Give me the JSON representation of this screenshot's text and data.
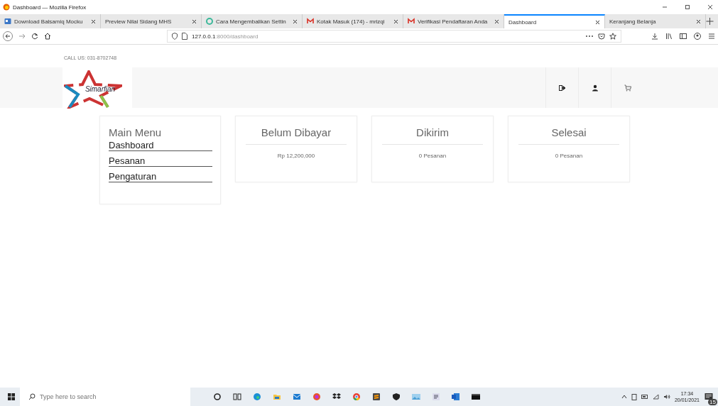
{
  "window": {
    "title": "Dashboard — Mozilla Firefox"
  },
  "tabs": [
    {
      "label": "Download Balsamiq Mocku",
      "kind": "tile",
      "selected": false
    },
    {
      "label": "Preview Nilai Sidang MHS",
      "kind": "plain",
      "selected": false
    },
    {
      "label": "Cara Mengembalikan Settin",
      "kind": "ring",
      "selected": false
    },
    {
      "label": "Kotak Masuk (174) - mrizqi",
      "kind": "mail",
      "selected": false
    },
    {
      "label": "Verifikasi Pendaftaran Anda",
      "kind": "mail",
      "selected": false
    },
    {
      "label": "Dashboard",
      "kind": "plain",
      "selected": true
    },
    {
      "label": "Keranjang Belanja",
      "kind": "plain",
      "selected": false
    }
  ],
  "address_bar": {
    "host": "127.0.0.1",
    "path": ":8000/dashboard"
  },
  "page": {
    "call_us": "CALL US: 031-8702748",
    "logo_text": "Simarfian",
    "main_menu": {
      "title": "Main Menu",
      "items": [
        "Dashboard",
        "Pesanan",
        "Pengaturan"
      ]
    },
    "cards": [
      {
        "title": "Belum Dibayar",
        "value": "Rp 12,200,000"
      },
      {
        "title": "Dikirim",
        "value": "0 Pesanan"
      },
      {
        "title": "Selesai",
        "value": "0 Pesanan"
      }
    ]
  },
  "taskbar": {
    "search_placeholder": "Type here to search",
    "time": "17:34",
    "date": "20/01/2021",
    "notifications": "15"
  }
}
